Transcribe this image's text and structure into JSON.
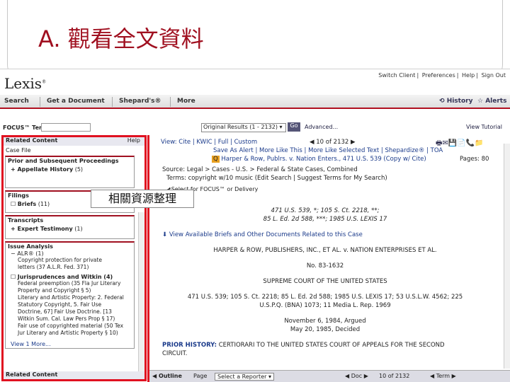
{
  "slide": {
    "title": "A. 觀看全文資料",
    "callout": "相關資源整理"
  },
  "app": {
    "logo": "Lexis",
    "top_links": [
      "Switch Client",
      "Preferences",
      "Help",
      "Sign Out"
    ],
    "nav": [
      "Search",
      "Get a Document",
      "Shepard's®",
      "More"
    ],
    "history": "History",
    "alerts": "Alerts"
  },
  "focus": {
    "label": "FOCUS™ Terms",
    "results_select": "Original Results (1 - 2132)",
    "go": "Go",
    "advanced": "Advanced...",
    "view_tutorial": "View Tutorial"
  },
  "left_panel": {
    "header": "Related Content",
    "help": "Help",
    "case_file": "Case File",
    "prior": {
      "title": "Prior and Subsequent Proceedings",
      "item": "+ Appellate History",
      "count": "(5)"
    },
    "filings": {
      "title": "Filings",
      "item": "Briefs",
      "count": "(11)"
    },
    "transcripts": {
      "title": "Transcripts",
      "item": "+ Expert Testimony",
      "count": "(1)"
    },
    "issue": {
      "title": "Issue Analysis",
      "alr": "− ALR® (1)",
      "alr_lines": [
        "Copyright protection for private",
        "letters (37 A.L.R. Fed. 371)"
      ],
      "jur": "Jurisprudences and Witkin (4)",
      "jur_lines": [
        "Federal preemption (35 Fla Jur Literary",
        "Property and Copyright § 5)",
        "Literary and Artistic Property: 2. Federal",
        "Statutory Copyright, 5. Fair Use",
        "Doctrine, 67] Fair Use Doctrine. [13",
        "Witkin Sum. Cal. Law Pers Prop § 17)",
        "Fair use of copyrighted material (50 Tex",
        "Jur Literary and Artistic Property § 10)"
      ],
      "more": "View 1 More..."
    },
    "footer": "Related Content"
  },
  "doc": {
    "view_line": "View: Cite | KWIC | Full | Custom",
    "counter": "10 of 2132",
    "links_line": "Save As Alert | More Like This | More Like Selected Text | Shepardize® | TOA",
    "case_line": "Harper & Row, Publrs. v. Nation Enters., 471 U.S. 539  (Copy w/ Cite)",
    "pages": "Pages: 80",
    "source_line": "Source: Legal > Cases - U.S. > Federal & State Cases, Combined",
    "terms_line": "Terms: copyright w/10 music  (Edit Search | Suggest Terms for My Search)",
    "focus_select": "Select for FOCUS™ or Delivery",
    "cite1": "471 U.S. 539, *; 105 S. Ct. 2218, **;",
    "cite2": "85 L. Ed. 2d 588, ***; 1985 U.S. LEXIS 17",
    "briefs_link": "View Available Briefs and Other Documents Related to this Case",
    "parties": "HARPER & ROW, PUBLISHERS, INC., ET AL. v. NATION ENTERPRISES ET AL.",
    "docket": "No. 83-1632",
    "court": "SUPREME COURT OF THE UNITED STATES",
    "citation1": "471 U.S. 539; 105 S. Ct. 2218; 85 L. Ed. 2d 588; 1985 U.S. LEXIS 17; 53 U.S.L.W. 4562; 225",
    "citation2": "U.S.P.Q. (BNA) 1073; 11 Media L. Rep. 1969",
    "argued": "November 6, 1984, Argued",
    "decided": "May 20, 1985, Decided",
    "prior_label": "PRIOR HISTORY:",
    "prior_text": "CERTIORARI TO THE UNITED STATES COURT OF APPEALS FOR THE SECOND",
    "prior_text2": "CIRCUIT."
  },
  "bottom": {
    "outline": "Outline",
    "page": "Page",
    "reporter": "Select a Reporter",
    "doc": "Doc",
    "doc_counter": "10 of 2132",
    "term": "Term"
  }
}
